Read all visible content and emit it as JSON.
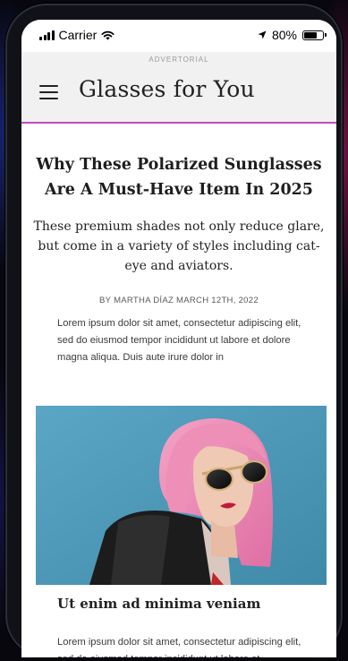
{
  "status_bar": {
    "carrier": "Carrier",
    "battery_percent": "80%",
    "battery_level": 0.8,
    "icons": [
      "signal-icon",
      "wifi-icon",
      "location-arrow-icon",
      "battery-icon"
    ]
  },
  "header": {
    "advertorial_label": "ADVERTORIAL",
    "site_title": "Glasses for You",
    "menu_icon": "hamburger-menu-icon",
    "accent_color": "#c64bbf"
  },
  "article": {
    "headline": "Why These Polarized Sunglasses Are A Must-Have Item In 2025",
    "subheadline": "These premium shades not only reduce glare, but come in a variety of styles including cat-eye and aviators.",
    "byline": "BY MARTHA DÍAZ MARCH 12TH, 2022",
    "intro_paragraph": "Lorem ipsum dolor sit amet, consectetur adipiscing elit, sed do eiusmod tempor incididunt ut labore et dolore magna aliqua. Duis aute irure dolor in",
    "section_title": "Ut enim ad minima veniam",
    "section_paragraph": "Lorem ipsum dolor sit amet, consectetur adipiscing elit, sed do eiusmod tempor incididunt ut labore et"
  },
  "colors": {
    "photo_background": "#4d98b6",
    "hair": "#ee8fb8",
    "jacket": "#1c1c1c"
  }
}
